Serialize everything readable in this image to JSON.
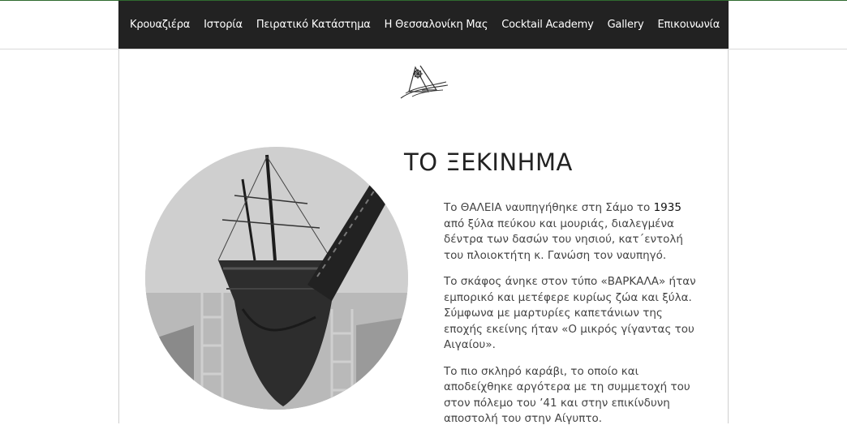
{
  "nav": {
    "items": [
      {
        "label": "Κρουαζιέρα"
      },
      {
        "label": "Ιστορία"
      },
      {
        "label": "Πειρατικό Κατάστημα"
      },
      {
        "label": "Η Θεσσαλονίκη Μας"
      },
      {
        "label": "Cocktail Academy"
      },
      {
        "label": "Gallery"
      },
      {
        "label": "Επικοινωνία"
      }
    ],
    "languages": [
      "greek-flag-icon",
      "us-flag-icon"
    ]
  },
  "section": {
    "title": "ΤΟ ΞΕΚΙΝΗΜΑ",
    "p1": {
      "a": "Το ΘΑΛΕΙΑ ναυπηγήθηκε στη Σάμο το ",
      "year": "1935",
      "b": " από ξύλα πεύκου και μουριάς, διαλεγμένα δέντρα των δασών του νησιού, κατ΄εντολή του πλοιοκτήτη κ. Γανώση τον ναυπηγό."
    },
    "p2": "Το σκάφος άνηκε στον τύπο «ΒΑΡΚΑΛΑ» ήταν εμπορικό και μετέφερε κυρίως ζώα και ξύλα. Σύμφωνα με μαρτυρίες καπετάνιων της εποχής εκείνης ήταν «Ο μικρός γίγαντας του Αιγαίου».",
    "p3": "Το πιο σκληρό καράβι, το οποίο και αποδείχθηκε αργότερα με τη συμμετοχή του στον πόλεμο του ’41 και στην επικίνδυνη αποστολή του στην Αίγυπτο."
  },
  "colors": {
    "nav_bg": "#222222",
    "nav_text": "#ffffff",
    "body_text": "#444444"
  },
  "icons": [
    "ship-logo-icon",
    "ship-photo"
  ]
}
